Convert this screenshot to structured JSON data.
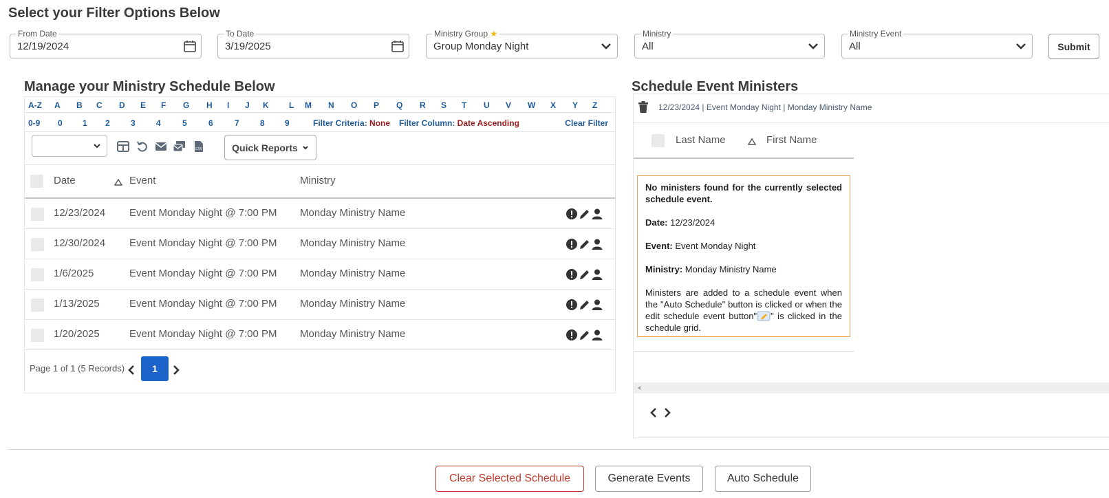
{
  "page_title": "Select your Filter Options Below",
  "filters": {
    "from_date": {
      "label": "From Date",
      "value": "12/19/2024"
    },
    "to_date": {
      "label": "To Date",
      "value": "3/19/2025"
    },
    "ministry_group": {
      "label": "Ministry Group",
      "star": "★",
      "value": "Group Monday Night"
    },
    "ministry": {
      "label": "Ministry",
      "value": "All"
    },
    "ministry_event": {
      "label": "Ministry Event",
      "value": "All"
    },
    "submit_label": "Submit"
  },
  "schedule": {
    "title": "Manage your Ministry Schedule Below",
    "alpha_row1": [
      "A-Z",
      "A",
      "B",
      "C",
      "D",
      "E",
      "F",
      "G",
      "H",
      "I",
      "J",
      "K",
      "L",
      "M",
      "N",
      "O",
      "P",
      "Q",
      "R",
      "S",
      "T",
      "U",
      "V",
      "W",
      "X",
      "Y",
      "Z"
    ],
    "alpha_row2": [
      "0-9",
      "0",
      "1",
      "2",
      "3",
      "4",
      "5",
      "6",
      "7",
      "8",
      "9"
    ],
    "filter_criteria_label": "Filter Criteria:",
    "filter_criteria_value": "None",
    "filter_column_label": "Filter Column:",
    "filter_column_value": "Date Ascending",
    "clear_filter_label": "Clear Filter",
    "quick_reports_label": "Quick Reports",
    "columns": {
      "date": "Date",
      "event": "Event",
      "ministry": "Ministry"
    },
    "rows": [
      {
        "date": "12/23/2024",
        "event": "Event Monday Night @ 7:00 PM",
        "ministry": "Monday Ministry Name"
      },
      {
        "date": "12/30/2024",
        "event": "Event Monday Night @ 7:00 PM",
        "ministry": "Monday Ministry Name"
      },
      {
        "date": "1/6/2025",
        "event": "Event Monday Night @ 7:00 PM",
        "ministry": "Monday Ministry Name"
      },
      {
        "date": "1/13/2025",
        "event": "Event Monday Night @ 7:00 PM",
        "ministry": "Monday Ministry Name"
      },
      {
        "date": "1/20/2025",
        "event": "Event Monday Night @ 7:00 PM",
        "ministry": "Monday Ministry Name"
      }
    ],
    "pager_text": "Page 1 of 1 (5 Records)",
    "current_page": "1"
  },
  "ministers": {
    "title": "Schedule Event Ministers",
    "event_line": "12/23/2024 | Event Monday Night | Monday Ministry Name",
    "columns": {
      "last_name": "Last Name",
      "first_name": "First Name"
    },
    "message": {
      "heading": "No ministers found for the currently selected schedule event.",
      "date_label": "Date:",
      "date_value": "12/23/2024",
      "event_label": "Event:",
      "event_value": "Event Monday Night",
      "ministry_label": "Ministry:",
      "ministry_value": "Monday Ministry Name",
      "help_part1": "Ministers are added to a schedule event when the \"Auto Schedule\" button is clicked or when the edit schedule event button\"",
      "help_part2": "\" is clicked in the schedule grid."
    }
  },
  "actions": {
    "clear_selected_schedule": "Clear Selected Schedule",
    "generate_events": "Generate Events",
    "auto_schedule": "Auto Schedule"
  },
  "colors": {
    "link_blue": "#1f5b9b",
    "filter_red": "#9b1c1c",
    "page_blue": "#1b63c9",
    "danger": "#c0392b",
    "warning_border": "#f0a050"
  }
}
